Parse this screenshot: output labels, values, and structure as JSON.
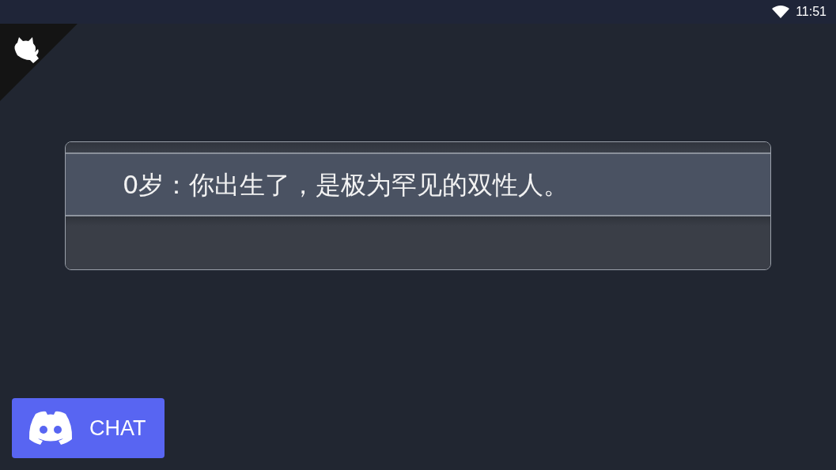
{
  "status_bar": {
    "time": "11:51"
  },
  "event_log": {
    "lines": [
      "0岁：你出生了，是极为罕见的双性人。"
    ]
  },
  "chat_button": {
    "label": "CHAT"
  }
}
